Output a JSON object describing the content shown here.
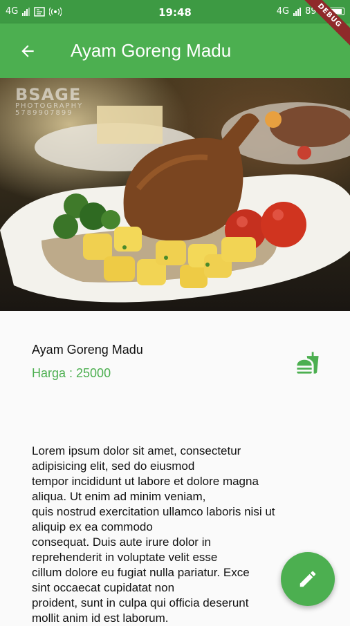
{
  "status_bar": {
    "network_left": "4G",
    "time": "19:48",
    "network_right": "4G",
    "battery": "89%"
  },
  "debug_banner": "DEBUG",
  "app_bar": {
    "title": "Ayam Goreng Madu",
    "back_icon": "arrow-back-icon"
  },
  "hero_image": {
    "watermark": {
      "line1": "BSAGE",
      "line2": "PHOTOGRAPHY",
      "line3": "5789907899"
    }
  },
  "food": {
    "name": "Ayam Goreng Madu",
    "price": "Harga : 25000",
    "icon": "fastfood-icon",
    "description": "Lorem ipsum dolor sit amet, consectetur\nadipisicing elit, sed do eiusmod\ntempor incididunt ut labore et dolore magna\naliqua. Ut enim ad minim veniam,\nquis nostrud exercitation ullamco laboris nisi ut\naliquip ex ea commodo\nconsequat. Duis aute irure dolor in\nreprehenderit in voluptate velit esse\ncillum dolore eu fugiat nulla pariatur. Exce\nsint occaecat cupidatat non\nproident, sunt in culpa qui officia deserunt\nmollit anim id est laborum."
  },
  "fab": {
    "icon": "edit-icon"
  },
  "colors": {
    "primary": "#4caf50",
    "status_bar": "#3d9a43",
    "debug_ribbon": "#8f2a2a"
  }
}
